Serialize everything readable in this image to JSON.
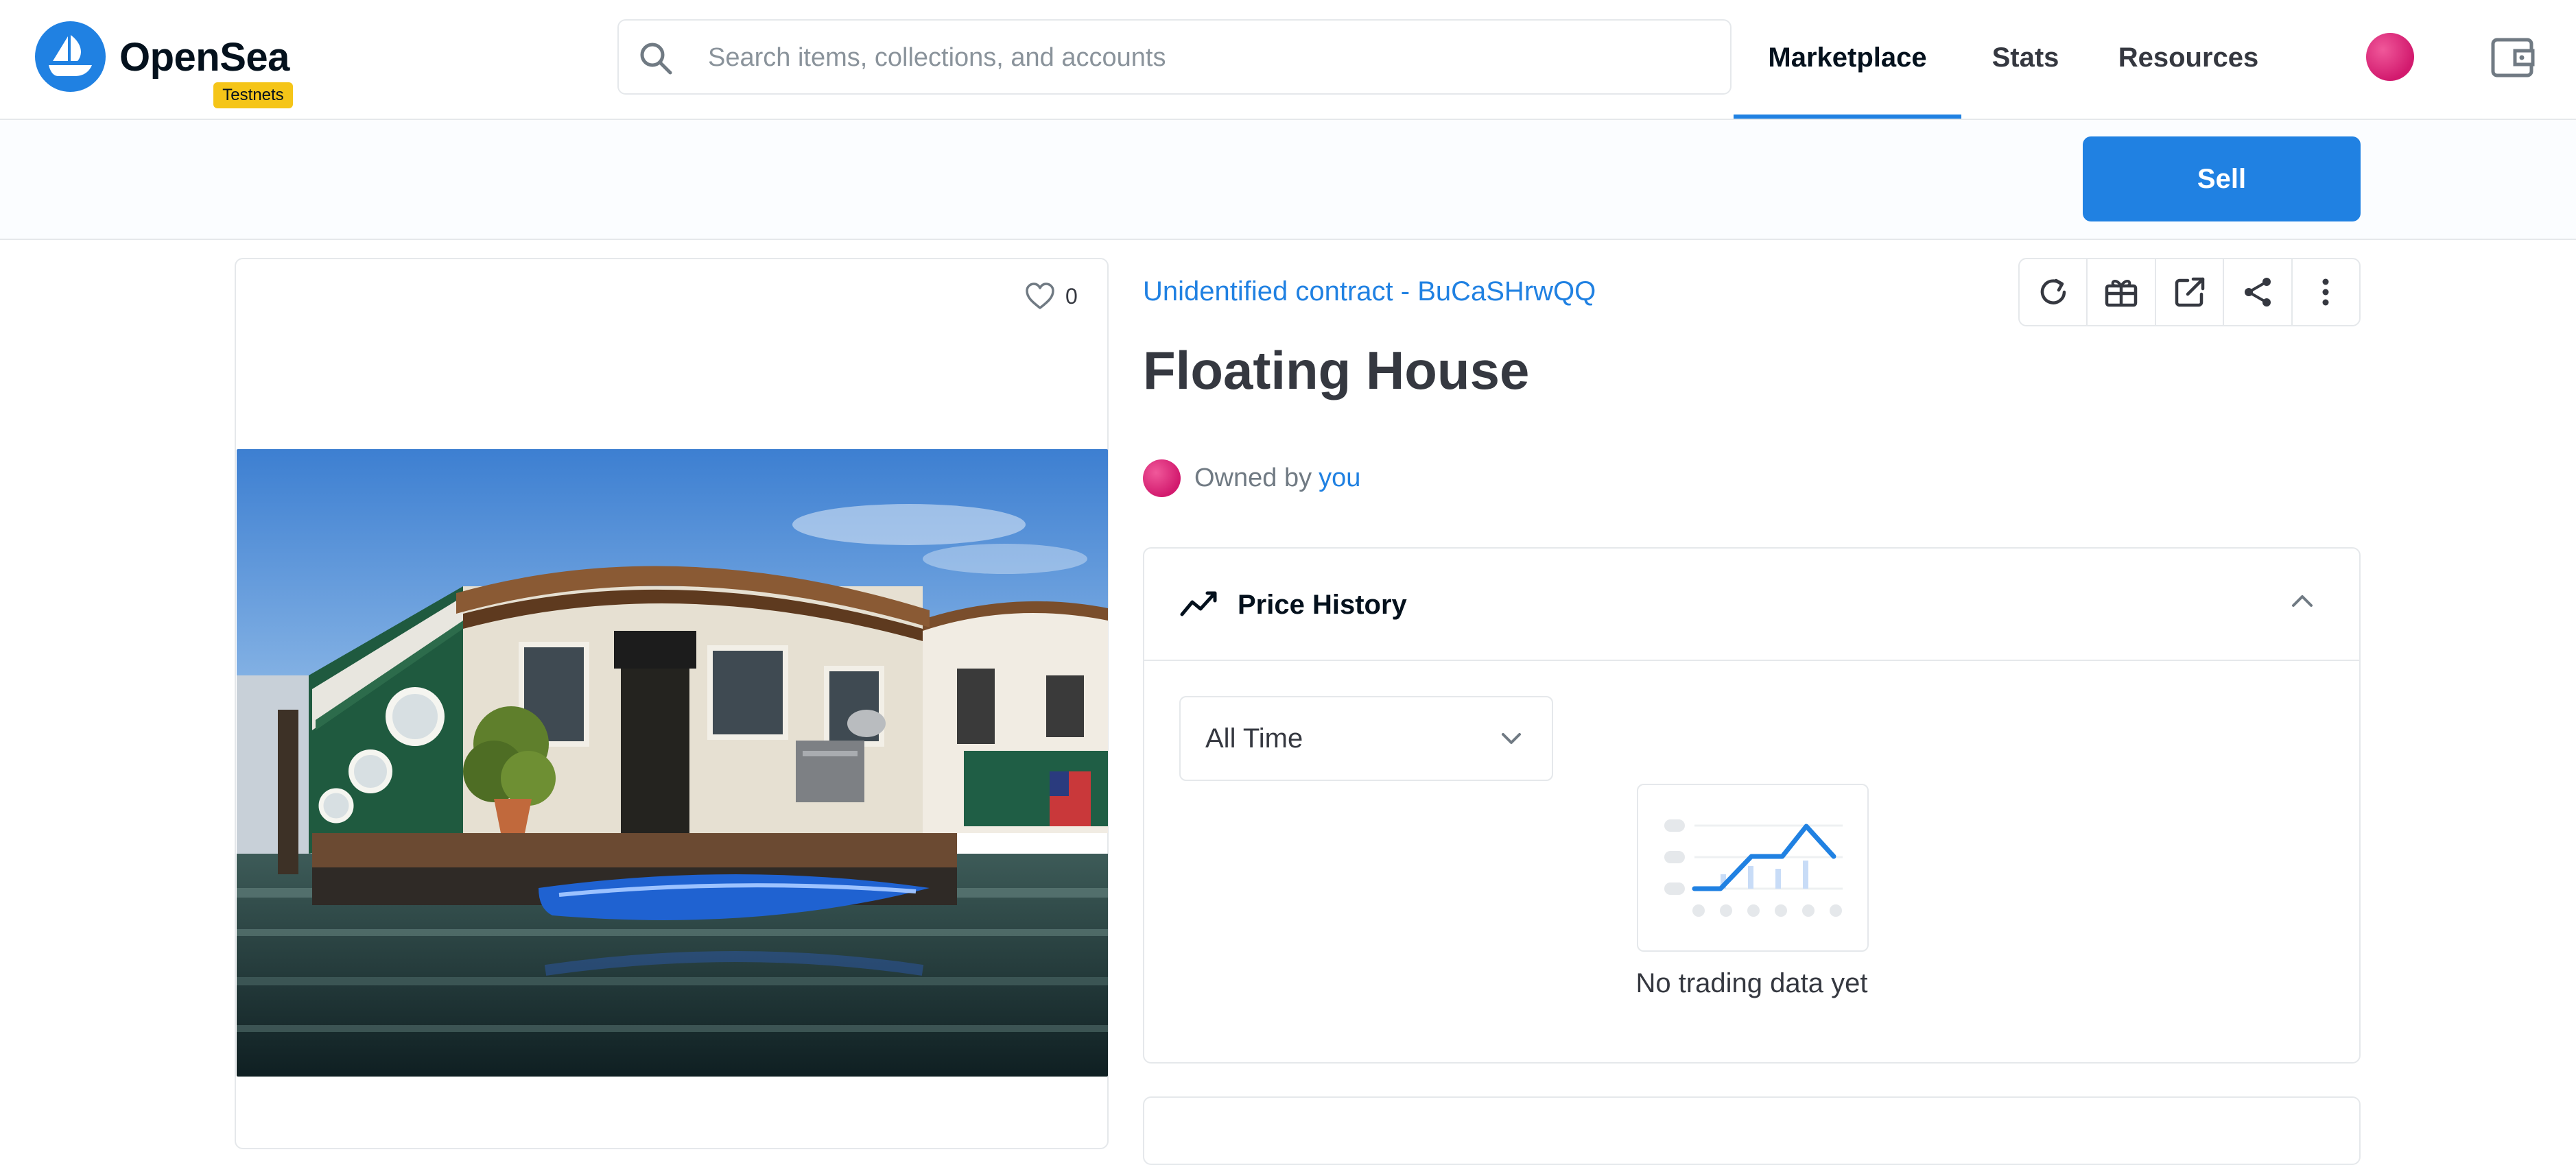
{
  "app": {
    "logo_text": "OpenSea",
    "badge": "Testnets",
    "brand_color": "#2081e2"
  },
  "search": {
    "placeholder": "Search items, collections, and accounts",
    "value": ""
  },
  "nav": {
    "items": [
      {
        "label": "Marketplace",
        "active": true
      },
      {
        "label": "Stats",
        "active": false
      },
      {
        "label": "Resources",
        "active": false
      }
    ],
    "icons": [
      "profile-avatar",
      "wallet-icon"
    ]
  },
  "subbar": {
    "sell_label": "Sell"
  },
  "asset": {
    "favorite_count": "0",
    "collection": "Unidentified contract - BuCaSHrwQQ",
    "title": "Floating House",
    "owned_by_label": "Owned by",
    "owner": "you"
  },
  "toolbar": {
    "icons": [
      "refresh-icon",
      "gift-icon",
      "external-link-icon",
      "share-icon",
      "more-icon"
    ]
  },
  "price_history": {
    "label": "Price History",
    "period": "All Time",
    "empty_text": "No trading data yet"
  }
}
